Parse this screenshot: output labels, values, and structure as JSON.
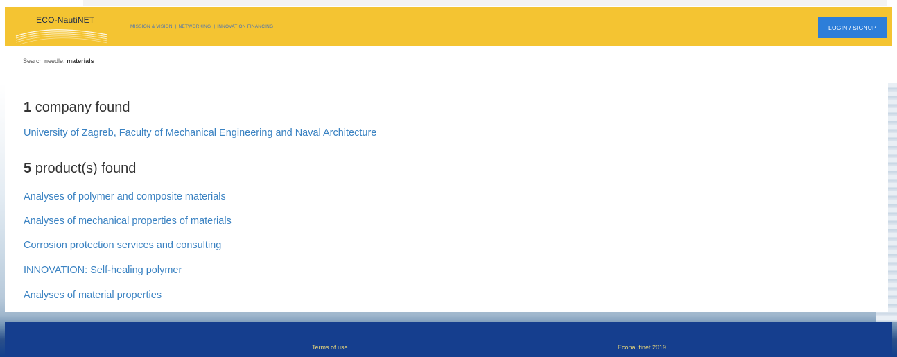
{
  "header": {
    "logo_text": "ECO-NautiNET",
    "nav": [
      {
        "label": "MISSION & VISION"
      },
      {
        "label": "NETWORKING"
      },
      {
        "label": "INNOVATION FINANCING"
      }
    ],
    "nav_separator": "|",
    "login_label": "LOGIN / SIGNUP"
  },
  "search": {
    "prefix": "Search needle:",
    "term": "materials"
  },
  "companies": {
    "count": "1",
    "label": "company found",
    "items": [
      "University of Zagreb, Faculty of Mechanical Engineering and Naval Architecture"
    ]
  },
  "products": {
    "count": "5",
    "label": "product(s) found",
    "items": [
      "Analyses of polymer and composite materials",
      "Analyses of mechanical properties of materials",
      "Corrosion protection services and consulting",
      "INNOVATION: Self-healing polymer",
      "Analyses of material properties"
    ]
  },
  "footer": {
    "terms": "Terms of use",
    "copyright": "Econautinet 2019"
  },
  "colors": {
    "navbar": "#f4c432",
    "link": "#3a82c2",
    "login_button": "#2d7ed9",
    "footer": "#153e8e"
  }
}
